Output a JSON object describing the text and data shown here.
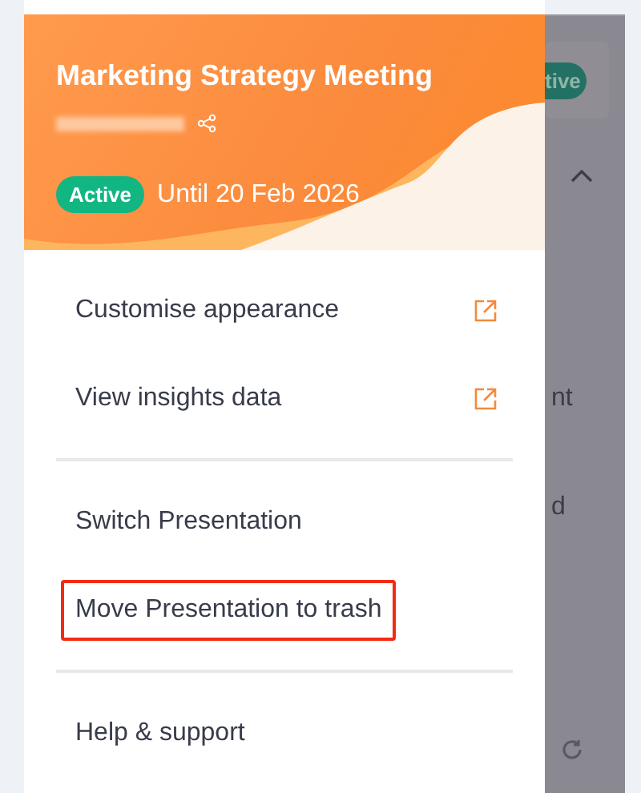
{
  "header": {
    "title": "Marketing Strategy Meeting",
    "status": "Active",
    "until": "Until 20 Feb 2026"
  },
  "menu_groups": [
    {
      "items": [
        {
          "label": "Customise appearance",
          "external": true,
          "highlighted": false
        },
        {
          "label": "View insights data",
          "external": true,
          "highlighted": false
        }
      ]
    },
    {
      "items": [
        {
          "label": "Switch Presentation",
          "external": false,
          "highlighted": false
        },
        {
          "label": "Move Presentation to trash",
          "external": false,
          "highlighted": true
        }
      ]
    },
    {
      "items": [
        {
          "label": "Help & support",
          "external": false,
          "highlighted": false
        }
      ]
    }
  ],
  "background": {
    "badge": "tive",
    "text_1": "nt",
    "text_2": "d"
  }
}
